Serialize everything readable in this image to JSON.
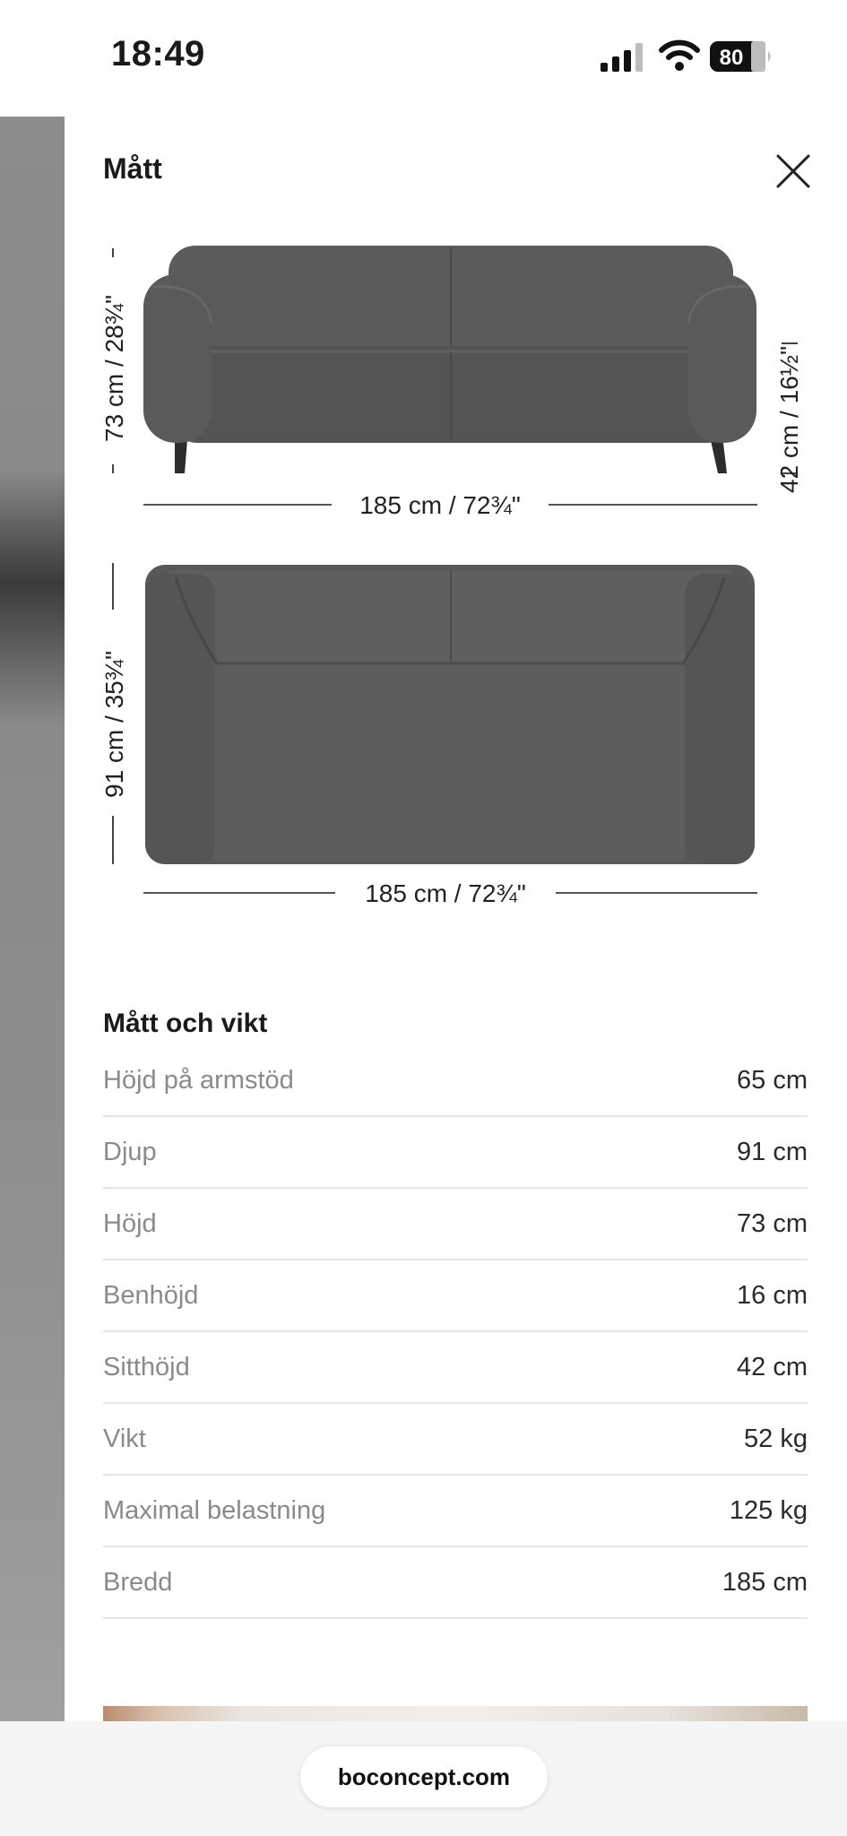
{
  "status_bar": {
    "time": "18:49",
    "battery_level": "80",
    "icons": [
      "cellular-signal-icon",
      "wifi-icon",
      "battery-icon"
    ]
  },
  "sheet": {
    "title": "Mått",
    "close_icon": "close-icon"
  },
  "diagram": {
    "front_height": "73 cm / 28¾\"",
    "seat_height": "42 cm / 16½\"",
    "front_width": "185 cm / 72¾\"",
    "top_depth": "91 cm / 35¾\"",
    "top_width": "185 cm / 72¾\"",
    "sofa_color": "#5a5a5a"
  },
  "specs": {
    "title": "Mått och vikt",
    "rows": [
      {
        "label": "Höjd på armstöd",
        "value": "65 cm"
      },
      {
        "label": "Djup",
        "value": "91 cm"
      },
      {
        "label": "Höjd",
        "value": "73 cm"
      },
      {
        "label": "Benhöjd",
        "value": "16 cm"
      },
      {
        "label": "Sitthöjd",
        "value": "42 cm"
      },
      {
        "label": "Vikt",
        "value": "52 kg"
      },
      {
        "label": "Maximal belastning",
        "value": "125 kg"
      },
      {
        "label": "Bredd",
        "value": "185 cm"
      }
    ]
  },
  "browser": {
    "url": "boconcept.com"
  }
}
